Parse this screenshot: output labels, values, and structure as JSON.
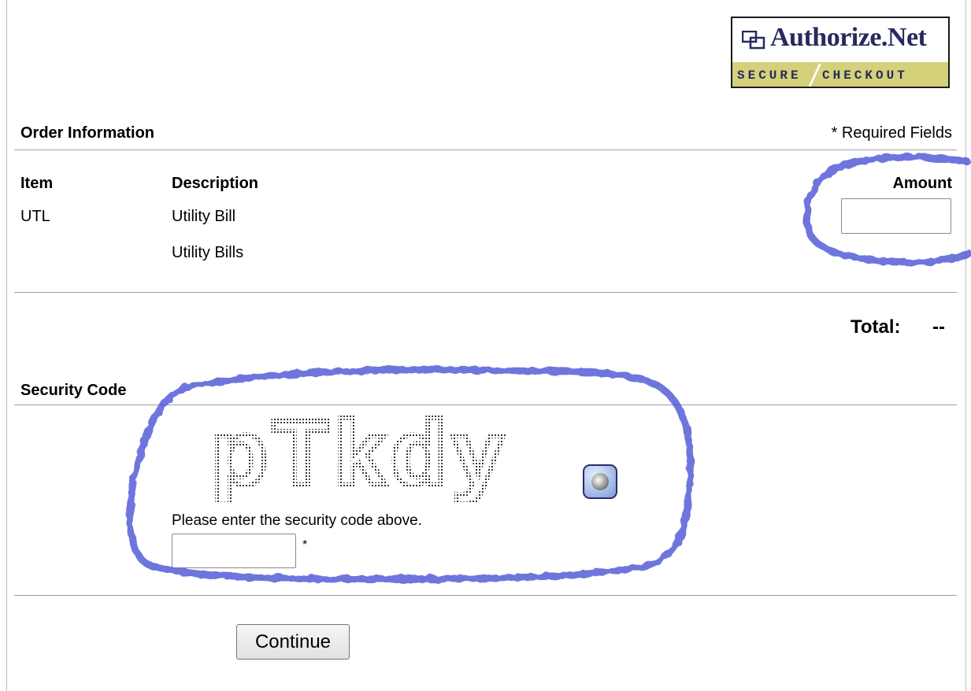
{
  "logo": {
    "brand": "Authorize.Net",
    "secure": "SECURE",
    "checkout": "CHECKOUT",
    "icon": "authorize-net-logo-icon"
  },
  "order": {
    "title": "Order Information",
    "required_note": "* Required Fields",
    "columns": {
      "item": "Item",
      "description": "Description",
      "amount": "Amount"
    },
    "rows": [
      {
        "item": "UTL",
        "description": "Utility Bill"
      },
      {
        "item": "",
        "description": "Utility Bills"
      }
    ],
    "amount_value": ""
  },
  "total": {
    "label": "Total:",
    "value": "--"
  },
  "security": {
    "title": "Security Code",
    "captcha_text": "pTkdy",
    "instruction": "Please enter the security code above.",
    "required_mark": "*",
    "input_value": "",
    "audio_icon": "audio-speaker-icon"
  },
  "actions": {
    "continue_label": "Continue"
  },
  "colors": {
    "annotation": "#3c46d2",
    "logo_navy": "#262a5c",
    "logo_band": "#d4d17a"
  }
}
